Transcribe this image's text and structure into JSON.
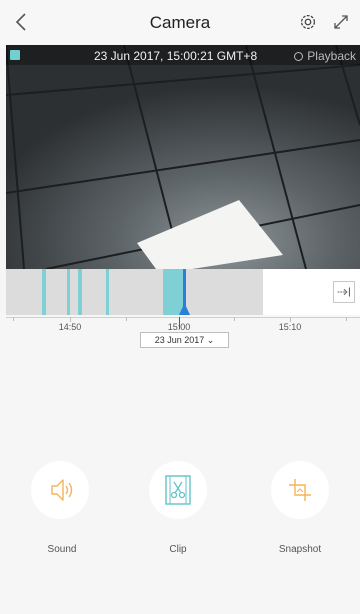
{
  "header": {
    "title": "Camera",
    "back_icon": "chevron-left-icon",
    "settings_icon": "gear-icon",
    "fullscreen_icon": "expand-icon"
  },
  "video": {
    "timestamp": "23 Jun 2017, 15:00:21 GMT+8",
    "playback_label": "Playback"
  },
  "timeline": {
    "tick_labels": [
      "14:50",
      "15:00",
      "15:10"
    ],
    "date_selected": "23 Jun 2017"
  },
  "actions": [
    {
      "label": "Sound",
      "icon": "speaker-icon"
    },
    {
      "label": "Clip",
      "icon": "scissors-icon"
    },
    {
      "label": "Snapshot",
      "icon": "crop-icon"
    }
  ],
  "colors": {
    "accent": "#7fd0d4",
    "playhead": "#2b7fd9",
    "icon_orange": "#f4b459",
    "recorded_bg": "#dcdcdc"
  }
}
